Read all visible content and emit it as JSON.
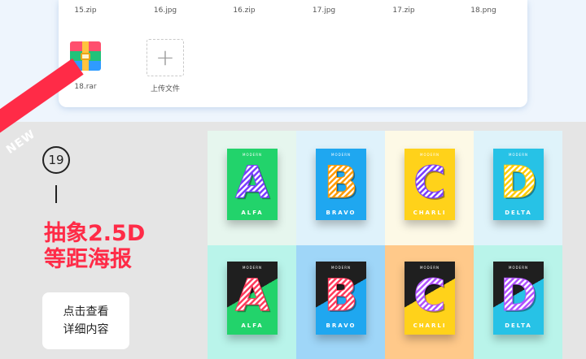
{
  "files": {
    "top_row": [
      "15.zip",
      "16.jpg",
      "16.zip",
      "17.jpg",
      "17.zip",
      "18.png"
    ],
    "rar_file": "18.rar",
    "upload_label": "上传文件"
  },
  "promo": {
    "new_badge": "NEW",
    "number": "19",
    "title_line1": "抽象2.5D",
    "title_line2": "等距海报",
    "button_line1": "点击查看",
    "button_line2": "详细内容"
  },
  "posters": [
    {
      "letter": "A",
      "name": "ALFA",
      "top_label": "MODERN",
      "bg": "#e6f6ee",
      "card": "#22d36b",
      "shape": "#7a3cff"
    },
    {
      "letter": "B",
      "name": "BRAVO",
      "top_label": "MODERN",
      "bg": "#dff2fb",
      "card": "#1fa7f0",
      "shape": "#ff9a00"
    },
    {
      "letter": "C",
      "name": "CHARLI",
      "top_label": "MODERN",
      "bg": "#fdf9e6",
      "card": "#ffd21a",
      "shape": "#7a3cff"
    },
    {
      "letter": "D",
      "name": "DELTA",
      "top_label": "MODERN",
      "bg": "#dff3fa",
      "card": "#27c2e6",
      "shape": "#ffcc00"
    },
    {
      "letter": "A",
      "name": "ALFA",
      "top_label": "MODERN",
      "bg": "#b9f4ea",
      "card": "#1f1f1f",
      "shape": "#ff3b5c"
    },
    {
      "letter": "B",
      "name": "BRAVO",
      "top_label": "MODERN",
      "bg": "#9fd6f8",
      "card": "#1f1f1f",
      "shape": "#ff3b5c"
    },
    {
      "letter": "C",
      "name": "CHARLI",
      "top_label": "MODERN",
      "bg": "#ffc98a",
      "card": "#1f1f1f",
      "shape": "#b052ff"
    },
    {
      "letter": "D",
      "name": "DELTA",
      "top_label": "MODERN",
      "bg": "#b9f4ea",
      "card": "#1f1f1f",
      "shape": "#b052ff"
    }
  ]
}
